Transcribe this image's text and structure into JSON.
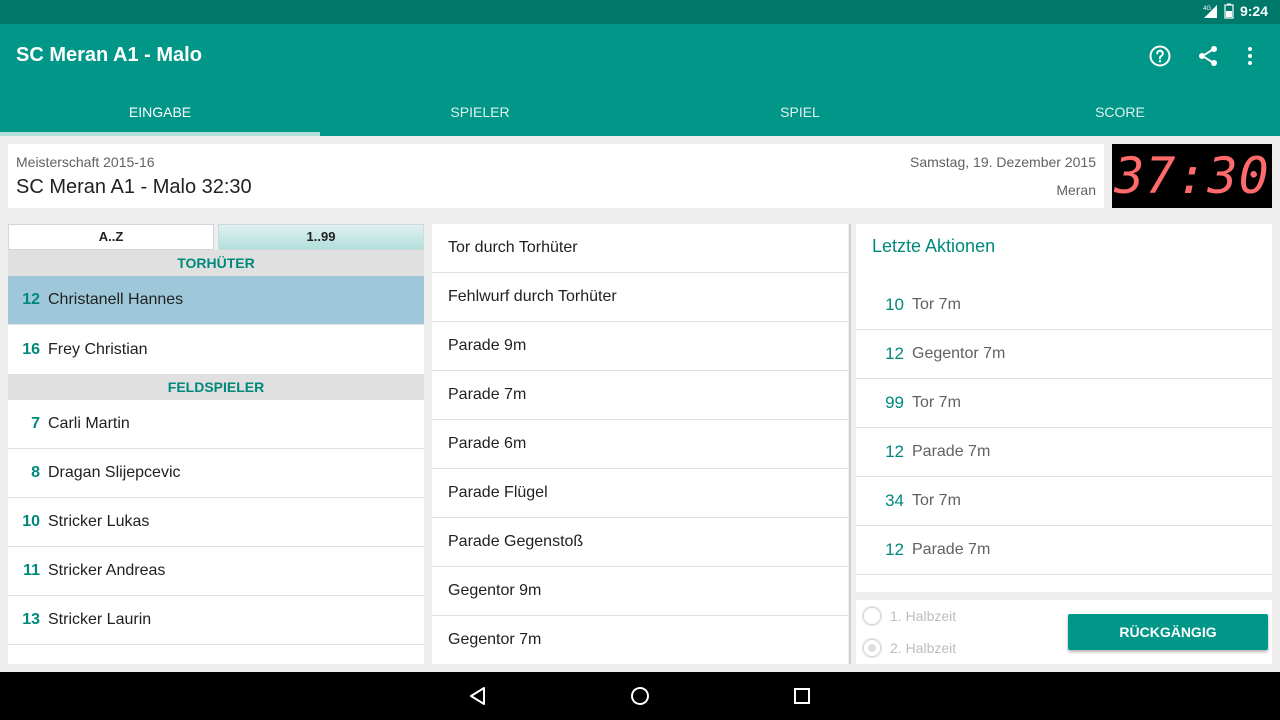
{
  "status_bar": {
    "network": "4G",
    "time": "9:24"
  },
  "app_bar": {
    "title": "SC Meran A1 - Malo",
    "icons": [
      "help-icon",
      "share-icon",
      "more-vert-icon"
    ],
    "tabs": [
      {
        "label": "EINGABE",
        "active": true
      },
      {
        "label": "SPIELER",
        "active": false
      },
      {
        "label": "SPIEL",
        "active": false
      },
      {
        "label": "SCORE",
        "active": false
      }
    ]
  },
  "match": {
    "competition": "Meisterschaft 2015-16",
    "title": "SC Meran A1 - Malo 32:30",
    "date": "Samstag, 19. Dezember 2015",
    "place": "Meran",
    "clock": "37:30"
  },
  "players": {
    "sort_buttons": [
      {
        "label": "A..Z",
        "active": false
      },
      {
        "label": "1..99",
        "active": true
      }
    ],
    "goalkeeper_header": "TORHÜTER",
    "goalkeepers": [
      {
        "number": "12",
        "name": "Christanell Hannes",
        "selected": true
      },
      {
        "number": "16",
        "name": "Frey Christian",
        "selected": false
      }
    ],
    "field_header": "FELDSPIELER",
    "field_players": [
      {
        "number": "7",
        "name": "Carli Martin"
      },
      {
        "number": "8",
        "name": "Dragan Slijepcevic"
      },
      {
        "number": "10",
        "name": "Stricker Lukas"
      },
      {
        "number": "11",
        "name": "Stricker Andreas"
      },
      {
        "number": "13",
        "name": "Stricker Laurin"
      }
    ]
  },
  "actions": [
    "Tor durch Torhüter",
    "Fehlwurf durch Torhüter",
    "Parade 9m",
    "Parade 7m",
    "Parade 6m",
    "Parade Flügel",
    "Parade Gegenstoß",
    "Gegentor 9m",
    "Gegentor 7m"
  ],
  "history": {
    "title": "Letzte Aktionen",
    "items": [
      {
        "number": "10",
        "action": "Tor 7m"
      },
      {
        "number": "12",
        "action": "Gegentor 7m"
      },
      {
        "number": "99",
        "action": "Tor 7m"
      },
      {
        "number": "12",
        "action": "Parade 7m"
      },
      {
        "number": "34",
        "action": "Tor 7m"
      },
      {
        "number": "12",
        "action": "Parade 7m"
      }
    ]
  },
  "halves": {
    "first": {
      "label": "1. Halbzeit",
      "checked": false
    },
    "second": {
      "label": "2. Halbzeit",
      "checked": true
    },
    "undo_label": "RÜCKGÄNGIG"
  },
  "colors": {
    "primary": "#009688",
    "primary_dark": "#00796b",
    "accent_text": "#00897b",
    "selected_row": "#9ec8da",
    "clock_digits": "#ff6b6b"
  }
}
